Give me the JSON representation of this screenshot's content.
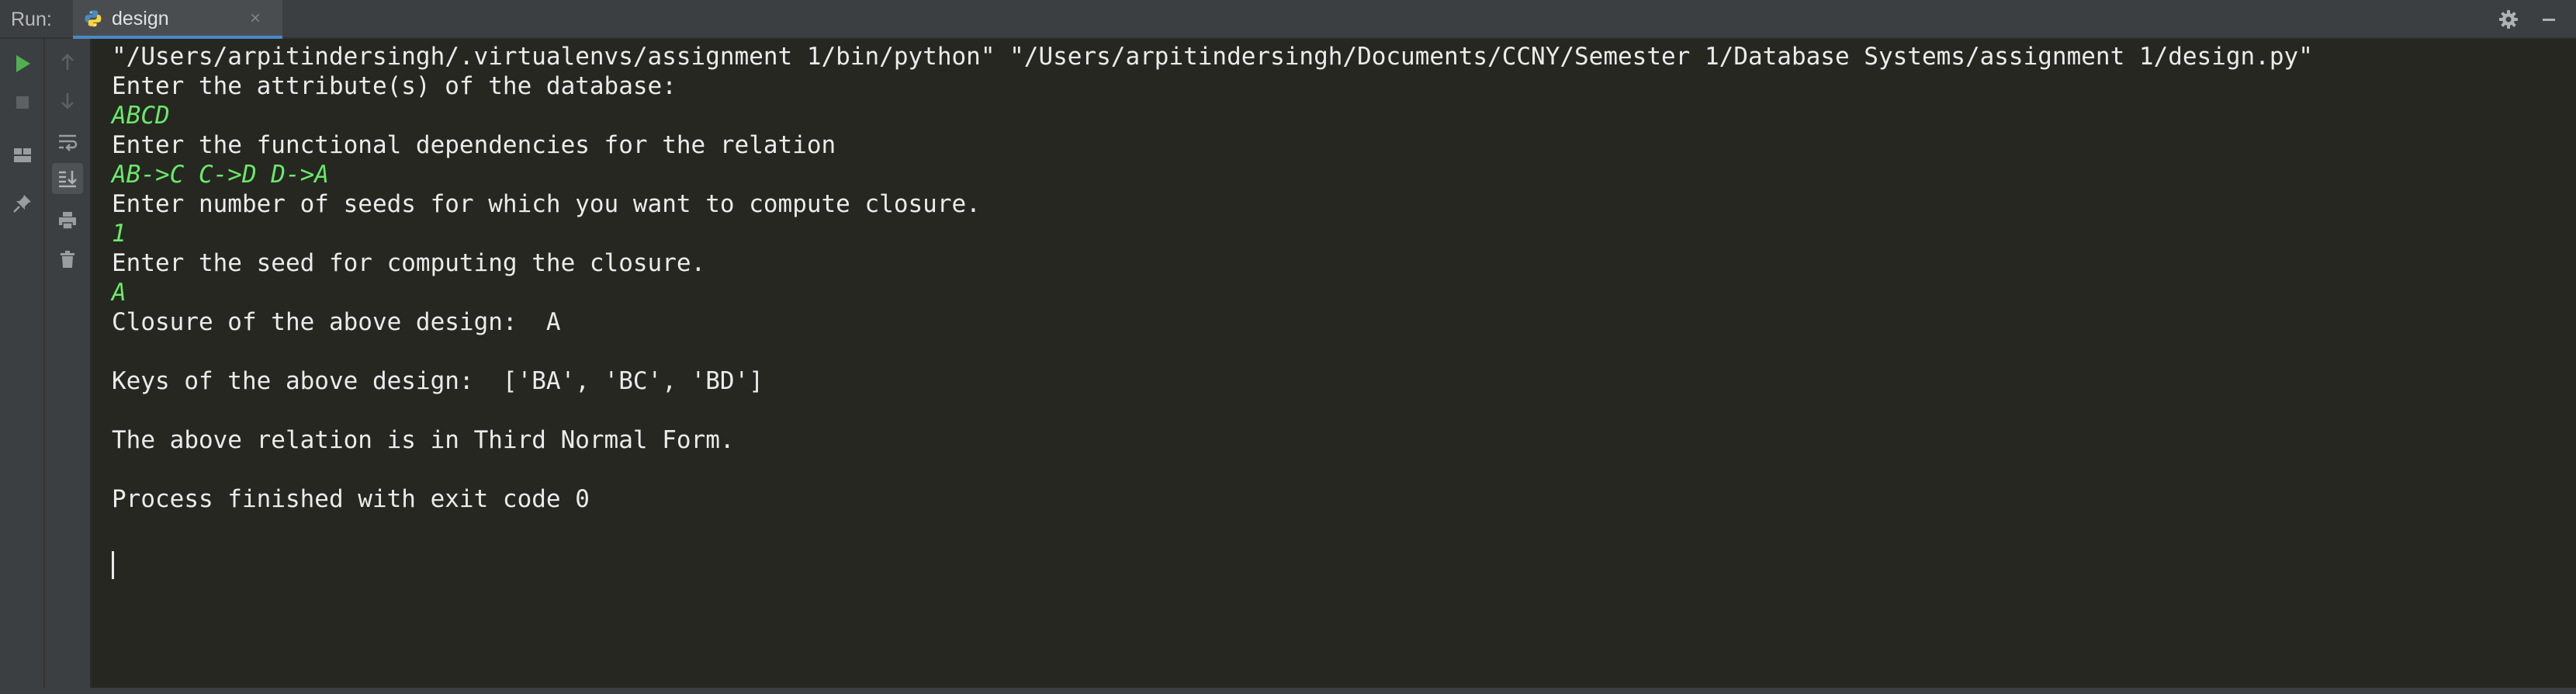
{
  "header": {
    "run_label": "Run:",
    "tab_label": "design",
    "tab_close": "×"
  },
  "toolbar": {
    "left_column": [
      "run-icon",
      "stop-icon",
      "layout-icon",
      "pin-icon"
    ],
    "right_column": [
      "up-arrow-icon",
      "down-arrow-icon",
      "soft-wrap-icon",
      "scroll-to-end-icon",
      "print-icon",
      "trash-icon"
    ]
  },
  "colors": {
    "console_bg": "#262721",
    "output_text": "#ebebeb",
    "input_text": "#6ae86a",
    "run_green": "#4fb14f",
    "tab_accent": "#4a88c7"
  },
  "console": {
    "lines": [
      {
        "text": "\"/Users/arpitindersingh/.virtualenvs/assignment 1/bin/python\" \"/Users/arpitindersingh/Documents/CCNY/Semester 1/Database Systems/assignment 1/design.py\"",
        "type": "output"
      },
      {
        "text": "Enter the attribute(s) of the database:",
        "type": "output"
      },
      {
        "text": "ABCD",
        "type": "input"
      },
      {
        "text": "Enter the functional dependencies for the relation",
        "type": "output"
      },
      {
        "text": "AB->C C->D D->A",
        "type": "input"
      },
      {
        "text": "Enter number of seeds for which you want to compute closure.",
        "type": "output"
      },
      {
        "text": "1",
        "type": "input"
      },
      {
        "text": "Enter the seed for computing the closure.",
        "type": "output"
      },
      {
        "text": "A",
        "type": "input"
      },
      {
        "text": "Closure of the above design:  A",
        "type": "output"
      },
      {
        "text": "",
        "type": "output"
      },
      {
        "text": "Keys of the above design:  ['BA', 'BC', 'BD']",
        "type": "output"
      },
      {
        "text": "",
        "type": "output"
      },
      {
        "text": "The above relation is in Third Normal Form.",
        "type": "output"
      },
      {
        "text": "",
        "type": "output"
      },
      {
        "text": "Process finished with exit code 0",
        "type": "output"
      }
    ]
  }
}
